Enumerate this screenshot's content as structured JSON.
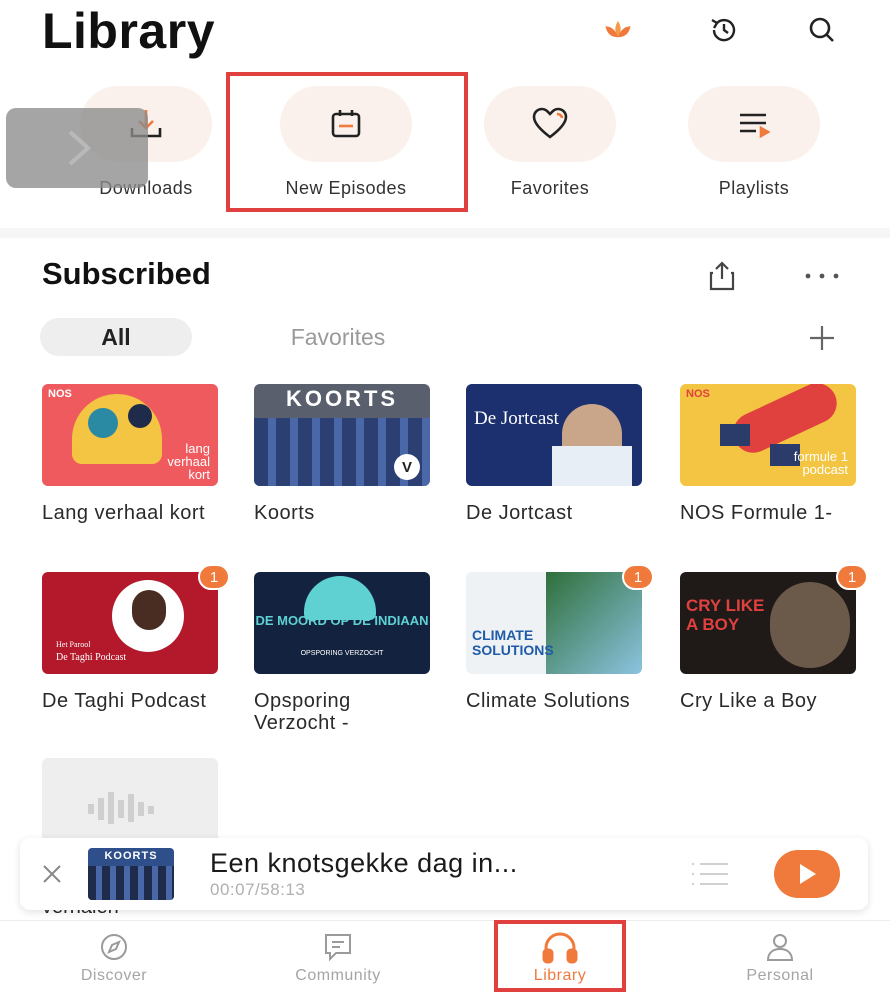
{
  "header": {
    "title": "Library"
  },
  "quick_access": [
    {
      "label": "Downloads",
      "icon": "download-icon"
    },
    {
      "label": "New Episodes",
      "icon": "calendar-icon"
    },
    {
      "label": "Favorites",
      "icon": "heart-icon"
    },
    {
      "label": "Playlists",
      "icon": "playlist-icon"
    }
  ],
  "subscribed": {
    "title": "Subscribed",
    "tabs": [
      {
        "label": "All",
        "active": true
      },
      {
        "label": "Favorites",
        "active": false
      }
    ],
    "podcasts": [
      {
        "label": "Lang verhaal kort",
        "cover_text": "lang verhaal kort",
        "tag": "NOS"
      },
      {
        "label": "Koorts",
        "cover_text": "KOORTS"
      },
      {
        "label": "De Jortcast",
        "cover_text": "De Jortcast"
      },
      {
        "label": "NOS Formule 1-",
        "cover_text": "formule 1 podcast",
        "tag": "NOS"
      },
      {
        "label": "De Taghi Podcast",
        "cover_text": "De Taghi Podcast",
        "cover_small": "Het Parool",
        "badge": "1"
      },
      {
        "label": "Opsporing Verzocht -",
        "cover_text": "DE MOORD OP DE INDIAAN",
        "cover_small": "OPSPORING VERZOCHT",
        "badge": "1"
      },
      {
        "label": "Climate Solutions",
        "cover_text": "CLIMATE SOLUTIONS",
        "badge": "1"
      },
      {
        "label": "Cry Like a Boy",
        "cover_text": "CRY LIKE A BOY",
        "badge": "1"
      },
      {
        "label": "verhalen",
        "cover_text": ""
      }
    ]
  },
  "mini_player": {
    "title": "Een knotsgekke dag in...",
    "time": "00:07/58:13",
    "thumb_text": "KOORTS"
  },
  "bottom_nav": [
    {
      "label": "Discover",
      "icon": "compass-icon",
      "active": false
    },
    {
      "label": "Community",
      "icon": "chat-icon",
      "active": false
    },
    {
      "label": "Library",
      "icon": "headphones-icon",
      "active": true
    },
    {
      "label": "Personal",
      "icon": "person-icon",
      "active": false
    }
  ],
  "colors": {
    "accent": "#f07a3c",
    "highlight": "#e0413f",
    "chip_bg": "#fbf1ec"
  }
}
